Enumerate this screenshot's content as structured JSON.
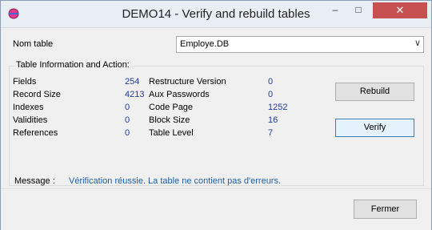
{
  "window": {
    "title": "DEMO14 - Verify and rebuild tables",
    "minimize_glyph": "–",
    "maximize_glyph": "□",
    "close_glyph": "✕"
  },
  "table_select": {
    "label": "Nom table",
    "value": "Employe.DB",
    "arrow": "∨"
  },
  "group": {
    "title": "Table Information and Action:",
    "left_fields": [
      {
        "label": "Fields",
        "value": "254"
      },
      {
        "label": "Record Size",
        "value": "4213"
      },
      {
        "label": "Indexes",
        "value": "0"
      },
      {
        "label": "Validities",
        "value": "0"
      },
      {
        "label": "References",
        "value": "0"
      }
    ],
    "right_fields": [
      {
        "label": "Restructure Version",
        "value": "0"
      },
      {
        "label": "Aux Passwords",
        "value": "0"
      },
      {
        "label": "Code Page",
        "value": "1252"
      },
      {
        "label": "Block Size",
        "value": "16"
      },
      {
        "label": "Table Level",
        "value": "7"
      }
    ],
    "rebuild_label": "Rebuild",
    "verify_label": "Verify"
  },
  "message": {
    "label": "Message :",
    "text": "Vérification réussie. La table ne contient pas d'erreurs."
  },
  "footer": {
    "close_label": "Fermer"
  },
  "colors": {
    "value_text": "#1f3d99",
    "message_text": "#1f5fa8",
    "close_button": "#c75050"
  }
}
